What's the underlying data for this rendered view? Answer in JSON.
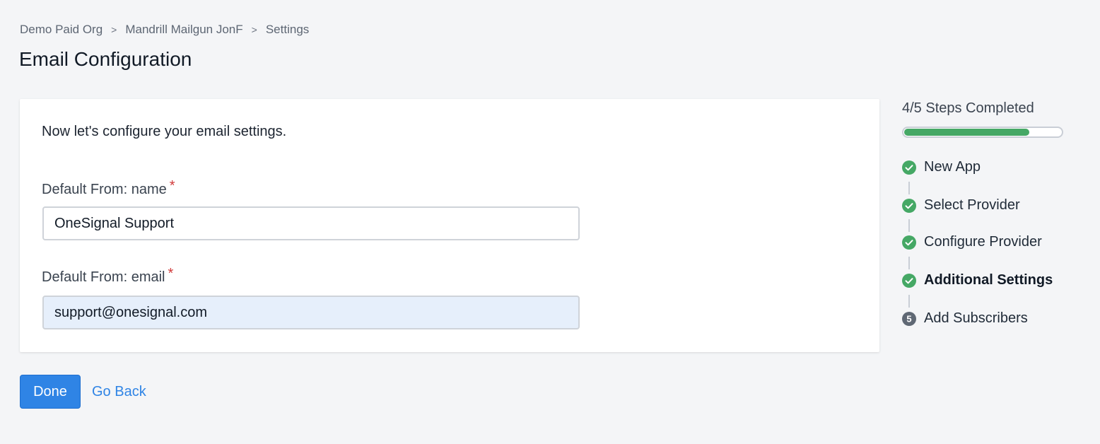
{
  "breadcrumb": {
    "items": [
      "Demo Paid Org",
      "Mandrill Mailgun JonF",
      "Settings"
    ],
    "separator": ">"
  },
  "page": {
    "title": "Email Configuration"
  },
  "form": {
    "intro": "Now let's configure your email settings.",
    "name_field": {
      "label": "Default From: name",
      "required_mark": "*",
      "value": "OneSignal Support"
    },
    "email_field": {
      "label": "Default From: email",
      "required_mark": "*",
      "value": "support@onesignal.com"
    }
  },
  "actions": {
    "done_label": "Done",
    "back_label": "Go Back"
  },
  "progress": {
    "label": "4/5 Steps Completed",
    "completed": 4,
    "total": 5,
    "fill_fraction": 0.8
  },
  "steps": [
    {
      "label": "New App",
      "status": "complete",
      "icon": "check-circle-icon"
    },
    {
      "label": "Select Provider",
      "status": "complete",
      "icon": "check-circle-icon"
    },
    {
      "label": "Configure Provider",
      "status": "complete",
      "icon": "check-circle-icon"
    },
    {
      "label": "Additional Settings",
      "status": "current",
      "icon": "check-circle-icon"
    },
    {
      "label": "Add Subscribers",
      "status": "pending",
      "icon": "step-number-icon",
      "number": "5"
    }
  ],
  "colors": {
    "accent": "#2f84e5",
    "success": "#45a865",
    "required": "#d13b3b",
    "pending_step": "#5f6874"
  }
}
